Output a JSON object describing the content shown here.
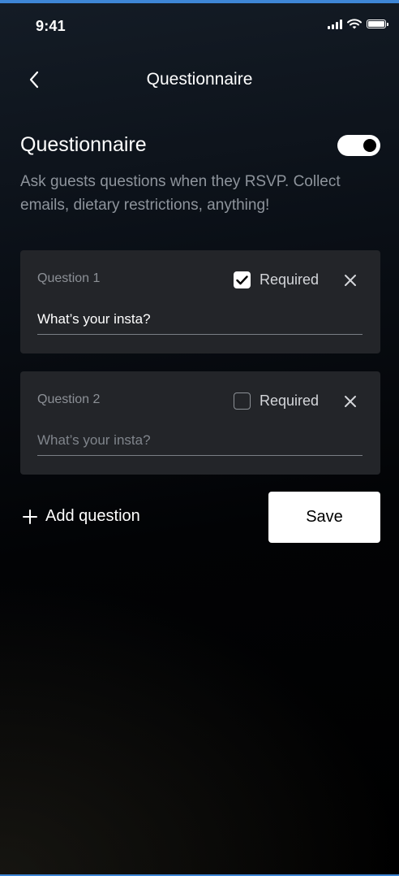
{
  "status_bar": {
    "time": "9:41"
  },
  "nav": {
    "title": "Questionnaire"
  },
  "section": {
    "title": "Questionnaire",
    "toggle_on": true,
    "description": "Ask guests questions when they RSVP. Collect emails, dietary restrictions, anything!"
  },
  "questions": [
    {
      "label": "Question 1",
      "required": true,
      "required_label": "Required",
      "value": "What’s your insta?",
      "placeholder": ""
    },
    {
      "label": "Question 2",
      "required": false,
      "required_label": "Required",
      "value": "",
      "placeholder": "What’s your insta?"
    }
  ],
  "actions": {
    "add_label": "Add question",
    "save_label": "Save"
  },
  "icons": [
    "back-chevron-icon",
    "signal-icon",
    "wifi-icon",
    "battery-icon",
    "checkmark-icon",
    "close-icon",
    "plus-icon"
  ],
  "colors": {
    "accent": "#3e86d6",
    "card": "#232529",
    "muted": "#8e949c"
  }
}
